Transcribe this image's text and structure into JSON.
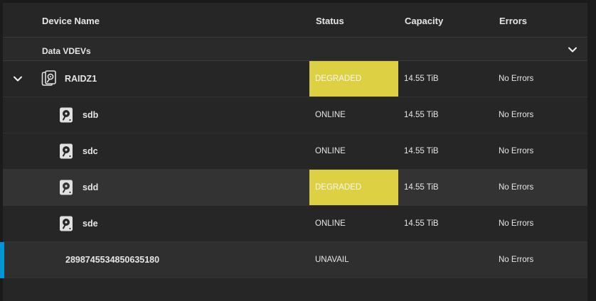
{
  "columns": {
    "device_name": "Device Name",
    "status": "Status",
    "capacity": "Capacity",
    "errors": "Errors"
  },
  "group": {
    "label": "Data VDEVs",
    "icon": "chevron-down-icon"
  },
  "rows": [
    {
      "name": "RAIDZ1",
      "status": "DEGRADED",
      "capacity": "14.55 TiB",
      "errors": "No Errors",
      "icon": "raid-disks-icon",
      "expandable": true
    },
    {
      "name": "sdb",
      "status": "ONLINE",
      "capacity": "14.55 TiB",
      "errors": "No Errors",
      "icon": "hard-disk-icon"
    },
    {
      "name": "sdc",
      "status": "ONLINE",
      "capacity": "14.55 TiB",
      "errors": "No Errors",
      "icon": "hard-disk-icon"
    },
    {
      "name": "sdd",
      "status": "DEGRADED",
      "capacity": "14.55 TiB",
      "errors": "No Errors",
      "icon": "hard-disk-icon"
    },
    {
      "name": "sde",
      "status": "ONLINE",
      "capacity": "14.55 TiB",
      "errors": "No Errors",
      "icon": "hard-disk-icon"
    },
    {
      "name": "2898745534850635180",
      "status": "UNAVAIL",
      "capacity": "",
      "errors": "No Errors"
    }
  ],
  "colors": {
    "degraded": "#ddd143",
    "selected_accent": "#0095d5"
  }
}
